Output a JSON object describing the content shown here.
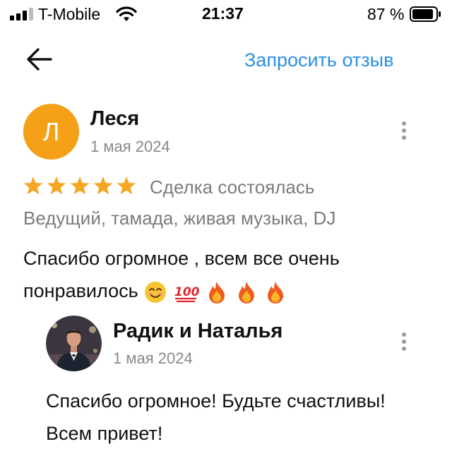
{
  "status_bar": {
    "carrier": "T-Mobile",
    "time": "21:37",
    "battery": "87 %"
  },
  "header": {
    "request_review": "Запросить отзыв"
  },
  "review": {
    "avatar_letter": "Л",
    "avatar_color": "#f5a016",
    "author": "Леся",
    "date": "1 мая 2024",
    "rating": 5,
    "deal_status": "Сделка состоялась",
    "category": "Ведущий, тамада, живая музыка, DJ",
    "text": "Спасибо огромное , всем все очень понравилось",
    "emojis": [
      "smiling-face-emoji",
      "hundred-points-emoji",
      "fire-emoji",
      "fire-emoji",
      "fire-emoji"
    ]
  },
  "reply": {
    "author": "Радик и Наталья",
    "date": "1 мая 2024",
    "text": "Спасибо огромное! Будьте счастливы! Всем привет!"
  },
  "colors": {
    "accent": "#2b8fe8",
    "star": "#f5a623",
    "muted": "#7c7c7c"
  }
}
